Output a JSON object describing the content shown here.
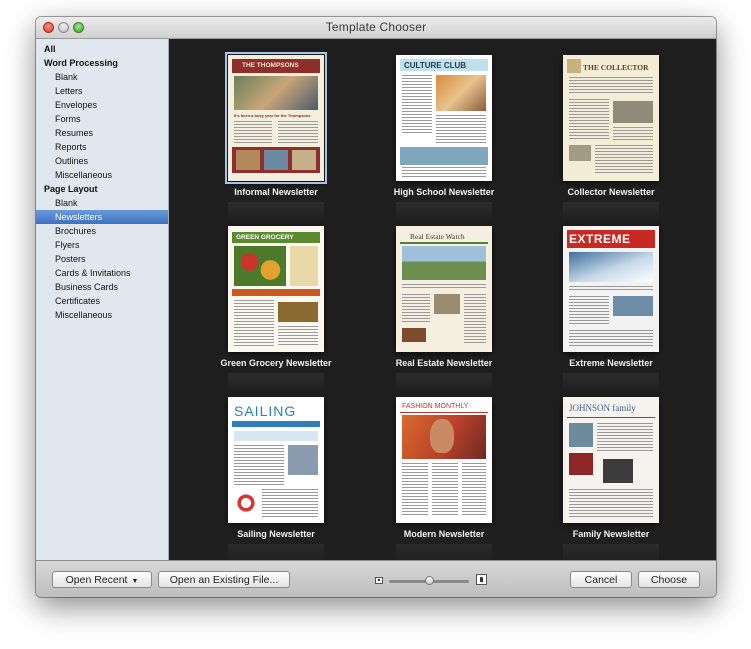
{
  "window": {
    "title": "Template Chooser"
  },
  "sidebar": {
    "items": [
      {
        "label": "All",
        "type": "header"
      },
      {
        "label": "Word Processing",
        "type": "header"
      },
      {
        "label": "Blank",
        "type": "item"
      },
      {
        "label": "Letters",
        "type": "item"
      },
      {
        "label": "Envelopes",
        "type": "item"
      },
      {
        "label": "Forms",
        "type": "item"
      },
      {
        "label": "Resumes",
        "type": "item"
      },
      {
        "label": "Reports",
        "type": "item"
      },
      {
        "label": "Outlines",
        "type": "item"
      },
      {
        "label": "Miscellaneous",
        "type": "item"
      },
      {
        "label": "Page Layout",
        "type": "header"
      },
      {
        "label": "Blank",
        "type": "item"
      },
      {
        "label": "Newsletters",
        "type": "item",
        "selected": true
      },
      {
        "label": "Brochures",
        "type": "item"
      },
      {
        "label": "Flyers",
        "type": "item"
      },
      {
        "label": "Posters",
        "type": "item"
      },
      {
        "label": "Cards & Invitations",
        "type": "item"
      },
      {
        "label": "Business Cards",
        "type": "item"
      },
      {
        "label": "Certificates",
        "type": "item"
      },
      {
        "label": "Miscellaneous",
        "type": "item"
      }
    ]
  },
  "templates": [
    {
      "label": "Informal Newsletter",
      "headline": "THE THOMPSONS",
      "caption": "It's been a busy year for the Thompsons",
      "selected": true
    },
    {
      "label": "High School Newsletter",
      "headline": "CULTURE CLUB"
    },
    {
      "label": "Collector Newsletter",
      "headline": "THE COLLECTOR"
    },
    {
      "label": "Green Grocery Newsletter",
      "headline": "GREEN GROCERY"
    },
    {
      "label": "Real Estate Newsletter",
      "headline": "Real Estate Watch"
    },
    {
      "label": "Extreme Newsletter",
      "headline": "EXTREME"
    },
    {
      "label": "Sailing Newsletter",
      "headline": "SAILING"
    },
    {
      "label": "Modern Newsletter",
      "headline": "FASHION MONTHLY"
    },
    {
      "label": "Family Newsletter",
      "headline": "JOHNSON family"
    }
  ],
  "colors": {
    "selection": "#3c72c3",
    "content_bg": "#1f1f1f",
    "sidebar_bg": "#e1e7ef"
  },
  "footer": {
    "open_recent": "Open Recent",
    "open_existing": "Open an Existing File...",
    "cancel": "Cancel",
    "choose": "Choose",
    "zoom_level": 0.5
  }
}
